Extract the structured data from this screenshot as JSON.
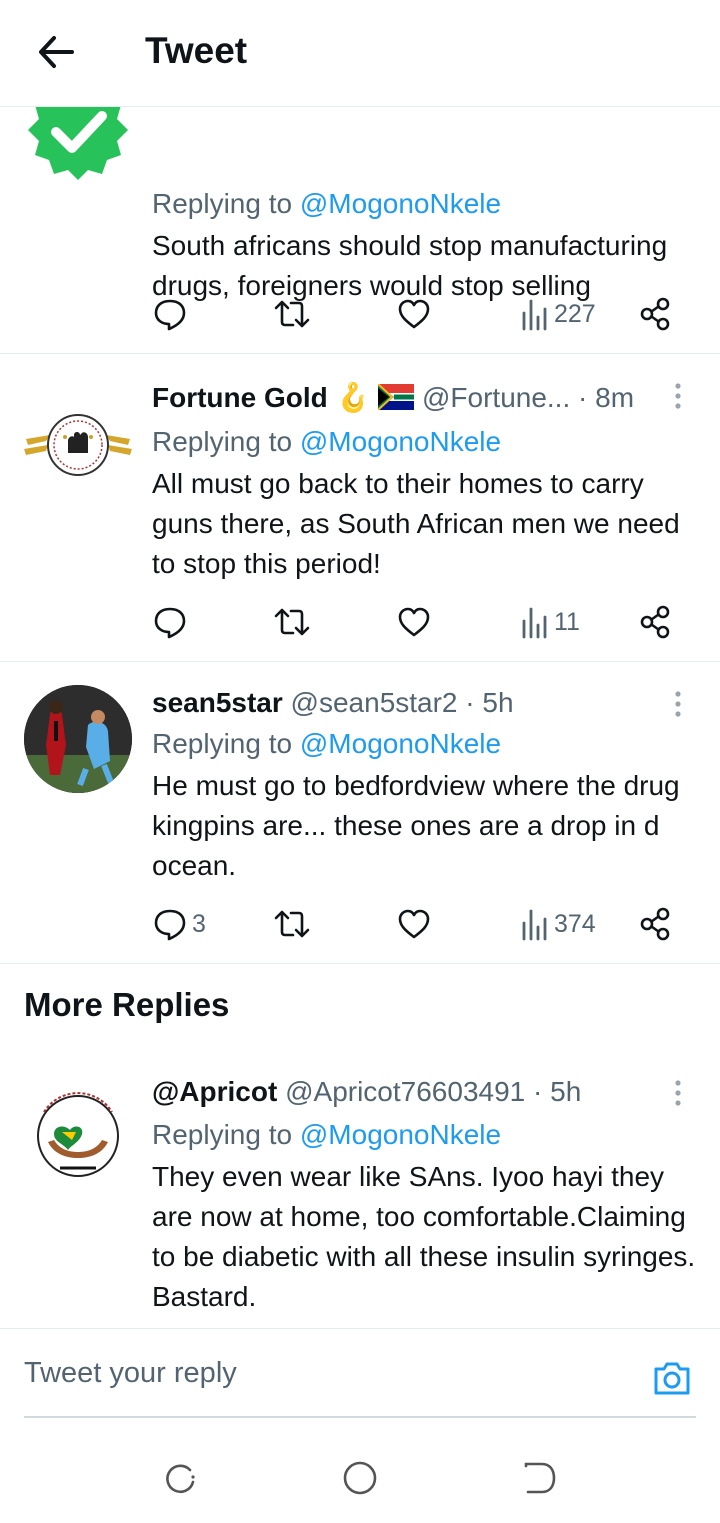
{
  "header": {
    "title": "Tweet"
  },
  "tweets": [
    {
      "avatar": "verified-badge-avatar",
      "replying_prefix": "Replying to",
      "replying_to": "@MogonoNkele",
      "text": "South africans should stop manufacturing drugs,  foreigners would stop selling",
      "stats": {
        "replies": "",
        "views": "227"
      }
    },
    {
      "name": "Fortune Gold",
      "emoji": "🪝",
      "handle": "@Fortune...",
      "dot": "·",
      "time": "8m",
      "replying_prefix": "Replying to",
      "replying_to": "@MogonoNkele",
      "text": "All must go back to their homes to carry guns there, as South African men we need to stop this period!",
      "stats": {
        "replies": "",
        "views": "11"
      }
    },
    {
      "name": "sean5star",
      "handle": "@sean5star2",
      "dot": "·",
      "time": "5h",
      "replying_prefix": "Replying to",
      "replying_to": "@MogonoNkele",
      "text": "He must go to bedfordview where the drug kingpins are... these ones are a drop in d ocean.",
      "stats": {
        "replies": "3",
        "views": "374"
      }
    }
  ],
  "more_replies": {
    "title": "More Replies",
    "tweet": {
      "name": "@Apricot",
      "handle": "@Apricot76603491",
      "dot": "·",
      "time": "5h",
      "replying_prefix": "Replying to",
      "replying_to": "@MogonoNkele",
      "text": "They even wear like SAns. Iyoo hayi they are now at home, too comfortable.Claiming to be diabetic with all these insulin syringes. Bastard."
    }
  },
  "reply_bar": {
    "placeholder": "Tweet your reply"
  },
  "colors": {
    "accent": "#1d9bf0",
    "muted": "#536471",
    "text": "#0f1419",
    "border": "#e6ecf0"
  },
  "icons": [
    "back-arrow-icon",
    "reply-icon",
    "retweet-icon",
    "like-icon",
    "views-icon",
    "share-icon",
    "more-icon",
    "camera-icon",
    "recents-icon",
    "home-icon",
    "back-nav-icon"
  ]
}
